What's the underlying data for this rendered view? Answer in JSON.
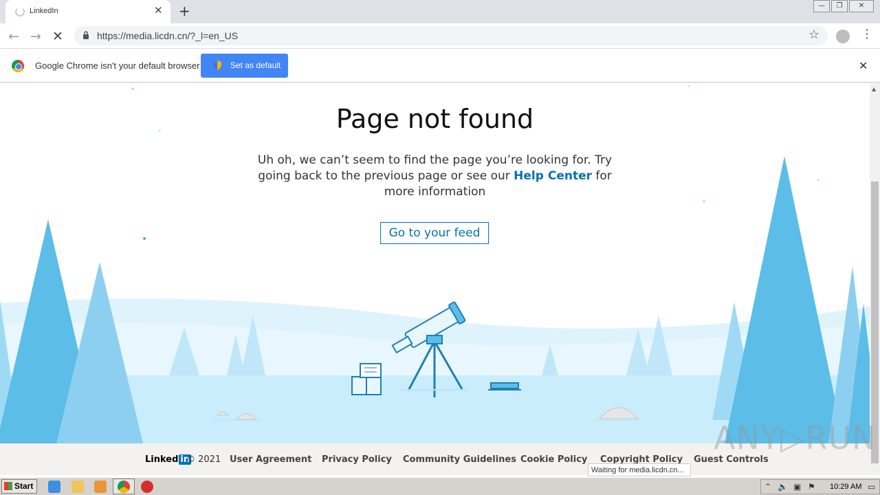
{
  "browser": {
    "tab_title": "LinkedIn",
    "url": "https://media.licdn.cn/?_l=en_US",
    "status_text": "Waiting for media.licdn.cn..."
  },
  "infobar": {
    "message": "Google Chrome isn't your default browser",
    "button_label": "Set as default"
  },
  "page": {
    "title": "Page not found",
    "message_before": "Uh oh, we can’t seem to find the page you’re looking for. Try going back to the previous page or see our",
    "help_link": "Help Center",
    "message_after": "for more information",
    "feed_button": "Go to your feed"
  },
  "footer": {
    "logo_text": "Linked",
    "logo_in": "in",
    "copyright": "© 2021",
    "links": [
      "User Agreement",
      "Privacy Policy",
      "Community Guidelines",
      "Cookie Policy",
      "Copyright Policy",
      "Guest Controls"
    ]
  },
  "watermark": "ANY▷RUN",
  "taskbar": {
    "start_label": "Start",
    "clock": "10:29 AM"
  },
  "colors": {
    "linkedin_blue": "#0073b1",
    "chrome_blue": "#4285f4",
    "tree_blue": "#5bbde8",
    "snow_blue": "#cfeffc"
  },
  "icons": {
    "tab_loading": "spinner-icon",
    "new_tab": "plus-icon",
    "back": "back-arrow-icon",
    "forward": "forward-arrow-icon",
    "stop": "stop-icon",
    "lock": "lock-icon",
    "bookmark": "star-icon",
    "profile": "profile-icon",
    "menu": "kebab-menu-icon",
    "close": "close-icon",
    "shield": "shield-icon"
  }
}
